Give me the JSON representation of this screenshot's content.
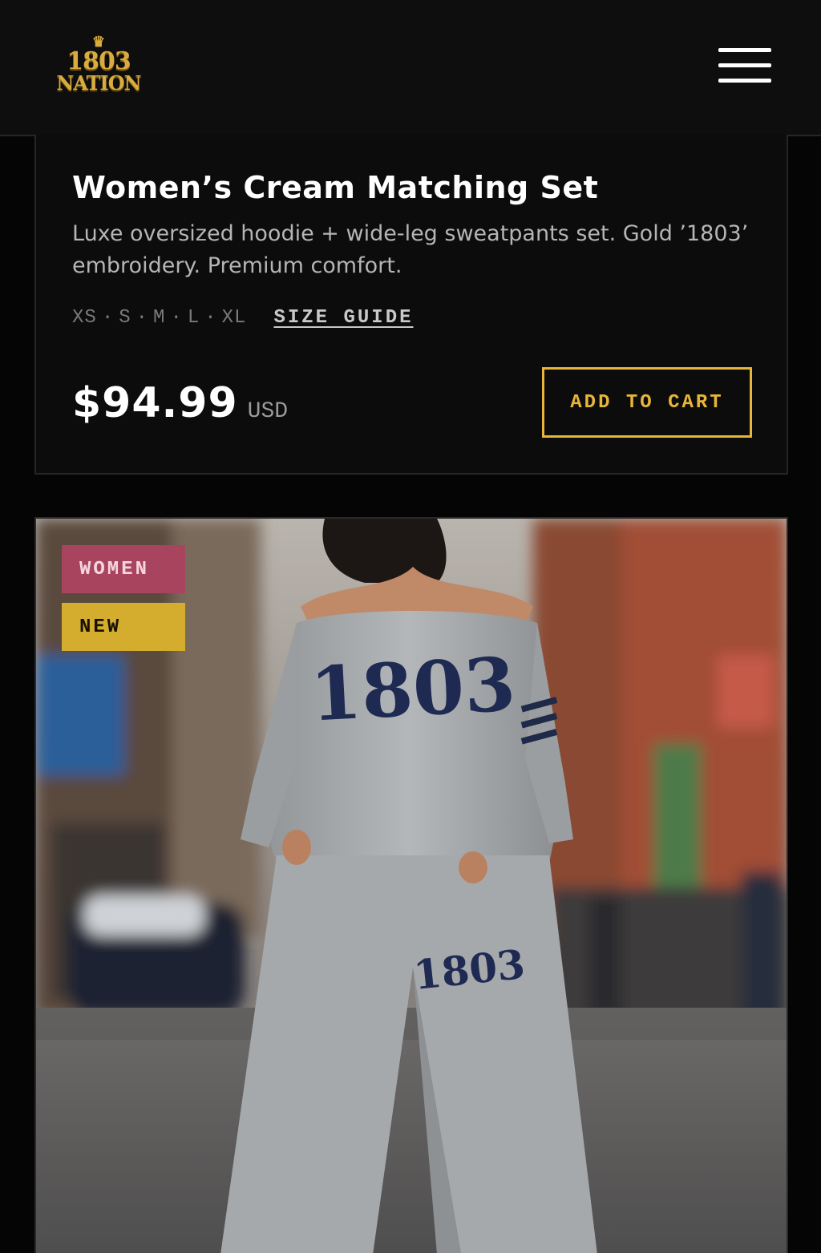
{
  "header": {
    "logo": {
      "crown_icon": "crown-icon",
      "line1": "1803",
      "line2": "NATION"
    },
    "menu_icon": "hamburger-menu-icon"
  },
  "product": {
    "title": "Women’s Cream Matching Set",
    "description": "Luxe oversized hoodie + wide-leg sweatpants set. Gold ’1803’ embroidery. Premium comfort.",
    "sizes": [
      "XS",
      "S",
      "M",
      "L",
      "XL"
    ],
    "size_separator": "·",
    "size_guide_label": "SIZE GUIDE",
    "price": "$94.99",
    "currency": "USD",
    "add_to_cart_label": "ADD TO CART"
  },
  "image_card": {
    "badges": [
      {
        "label": "WOMEN",
        "color": "#a8445e"
      },
      {
        "label": "NEW",
        "color": "#d4ac2e"
      }
    ],
    "photo_text": {
      "chest": "1803",
      "leg": "1803"
    }
  },
  "colors": {
    "background": "#050505",
    "card": "#0c0c0c",
    "accent_gold": "#e6b53a",
    "text_muted": "#b5b5b5"
  }
}
